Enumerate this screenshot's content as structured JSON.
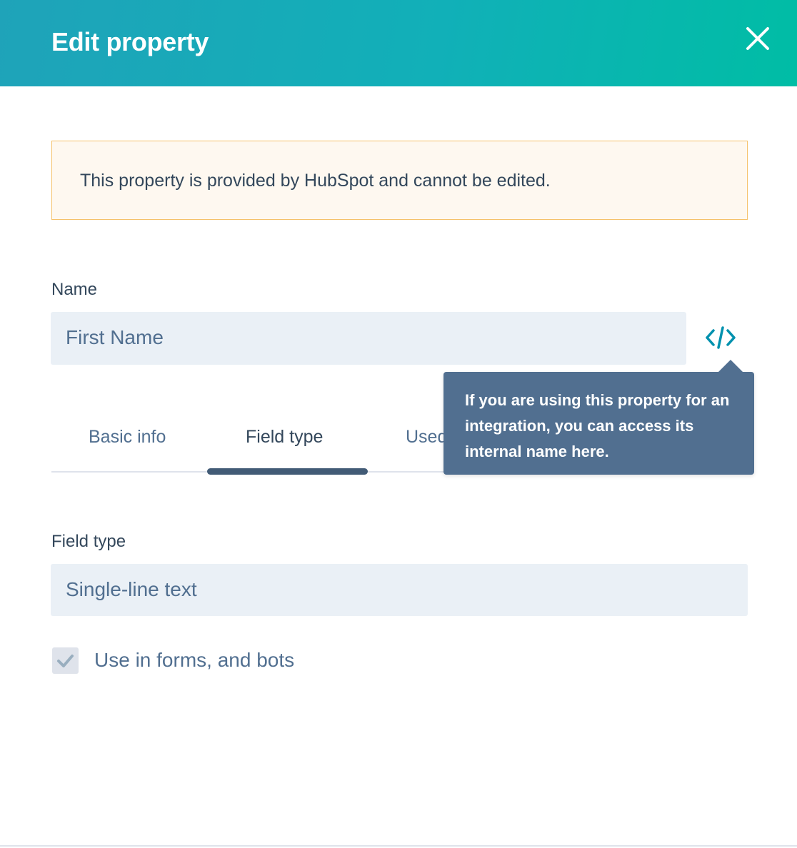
{
  "header": {
    "title": "Edit property",
    "close_icon": "close-icon",
    "background_start": "#1fa3b9",
    "background_end": "#00bda5"
  },
  "alert": {
    "message": "This property is provided by HubSpot and cannot be edited.",
    "background": "#fef8f0",
    "border": "#f5c26b"
  },
  "name_field": {
    "label": "Name",
    "value": "First Name",
    "code_icon": "code-icon"
  },
  "tooltip": {
    "text": "If you are using this property for an integration, you can access its internal name here."
  },
  "tabs": [
    {
      "label": "Basic info",
      "active": false
    },
    {
      "label": "Field type",
      "active": true
    },
    {
      "label": "Used",
      "active": false
    }
  ],
  "field_type": {
    "label": "Field type",
    "value": "Single-line text"
  },
  "checkbox": {
    "label": "Use in forms, and bots",
    "checked": true,
    "icon": "checkmark-icon"
  },
  "colors": {
    "text_primary": "#33475b",
    "text_secondary": "#516f90",
    "input_bg": "#eaf0f6",
    "accent": "#00a4bd",
    "tooltip_bg": "#516f90",
    "tab_indicator": "#425b76"
  }
}
